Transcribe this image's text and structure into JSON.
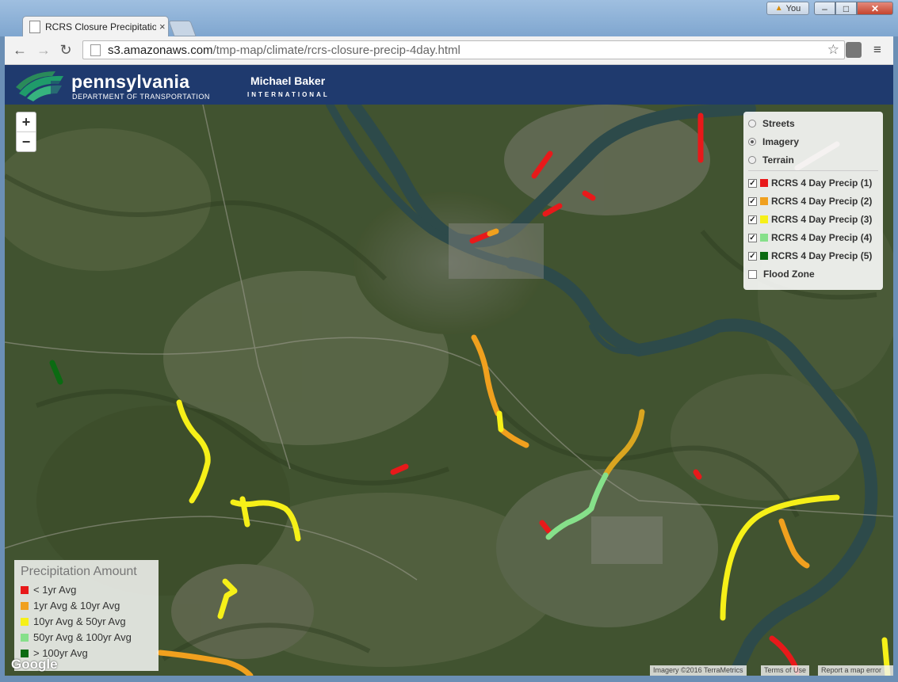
{
  "browser": {
    "tab_title": "RCRS Closure Precipitatio",
    "tab_close": "×",
    "user_label": "You",
    "url_host": "s3.amazonaws.com",
    "url_path": "/tmp-map/climate/rcrs-closure-precip-4day.html",
    "window_buttons": {
      "minimize": "–",
      "maximize": "□",
      "close": "✕"
    },
    "nav": {
      "back": "←",
      "forward": "→",
      "reload": "↻"
    },
    "star_icon": "☆",
    "menu_icon": "≡"
  },
  "header": {
    "brand": "pennsylvania",
    "brand_sub": "DEPARTMENT OF TRANSPORTATION",
    "partner": "Michael Baker",
    "partner_sub": "INTERNATIONAL"
  },
  "map": {
    "zoom_in": "+",
    "zoom_out": "−",
    "basemaps": [
      {
        "label": "Streets",
        "selected": false
      },
      {
        "label": "Imagery",
        "selected": true
      },
      {
        "label": "Terrain",
        "selected": false
      }
    ],
    "overlays": [
      {
        "label": "RCRS 4 Day Precip (1)",
        "color": "#e8191a",
        "checked": true
      },
      {
        "label": "RCRS 4 Day Precip (2)",
        "color": "#f0a01e",
        "checked": true
      },
      {
        "label": "RCRS 4 Day Precip (3)",
        "color": "#f6f018",
        "checked": true
      },
      {
        "label": "RCRS 4 Day Precip (4)",
        "color": "#86e08a",
        "checked": true
      },
      {
        "label": "RCRS 4 Day Precip (5)",
        "color": "#0b6b12",
        "checked": true
      },
      {
        "label": "Flood Zone",
        "color": "",
        "checked": false
      }
    ],
    "legend": {
      "title": "Precipitation Amount",
      "items": [
        {
          "label": "< 1yr Avg",
          "color": "#e8191a"
        },
        {
          "label": "1yr Avg & 10yr Avg",
          "color": "#f0a01e"
        },
        {
          "label": "10yr Avg & 50yr Avg",
          "color": "#f6f018"
        },
        {
          "label": "50yr Avg & 100yr Avg",
          "color": "#86e08a"
        },
        {
          "label": "> 100yr Avg",
          "color": "#0b6b12"
        }
      ]
    },
    "google_logo": "Google",
    "attribution": {
      "imagery": "Imagery ©2016 TerraMetrics",
      "terms": "Terms of Use",
      "report": "Report a map error"
    }
  }
}
